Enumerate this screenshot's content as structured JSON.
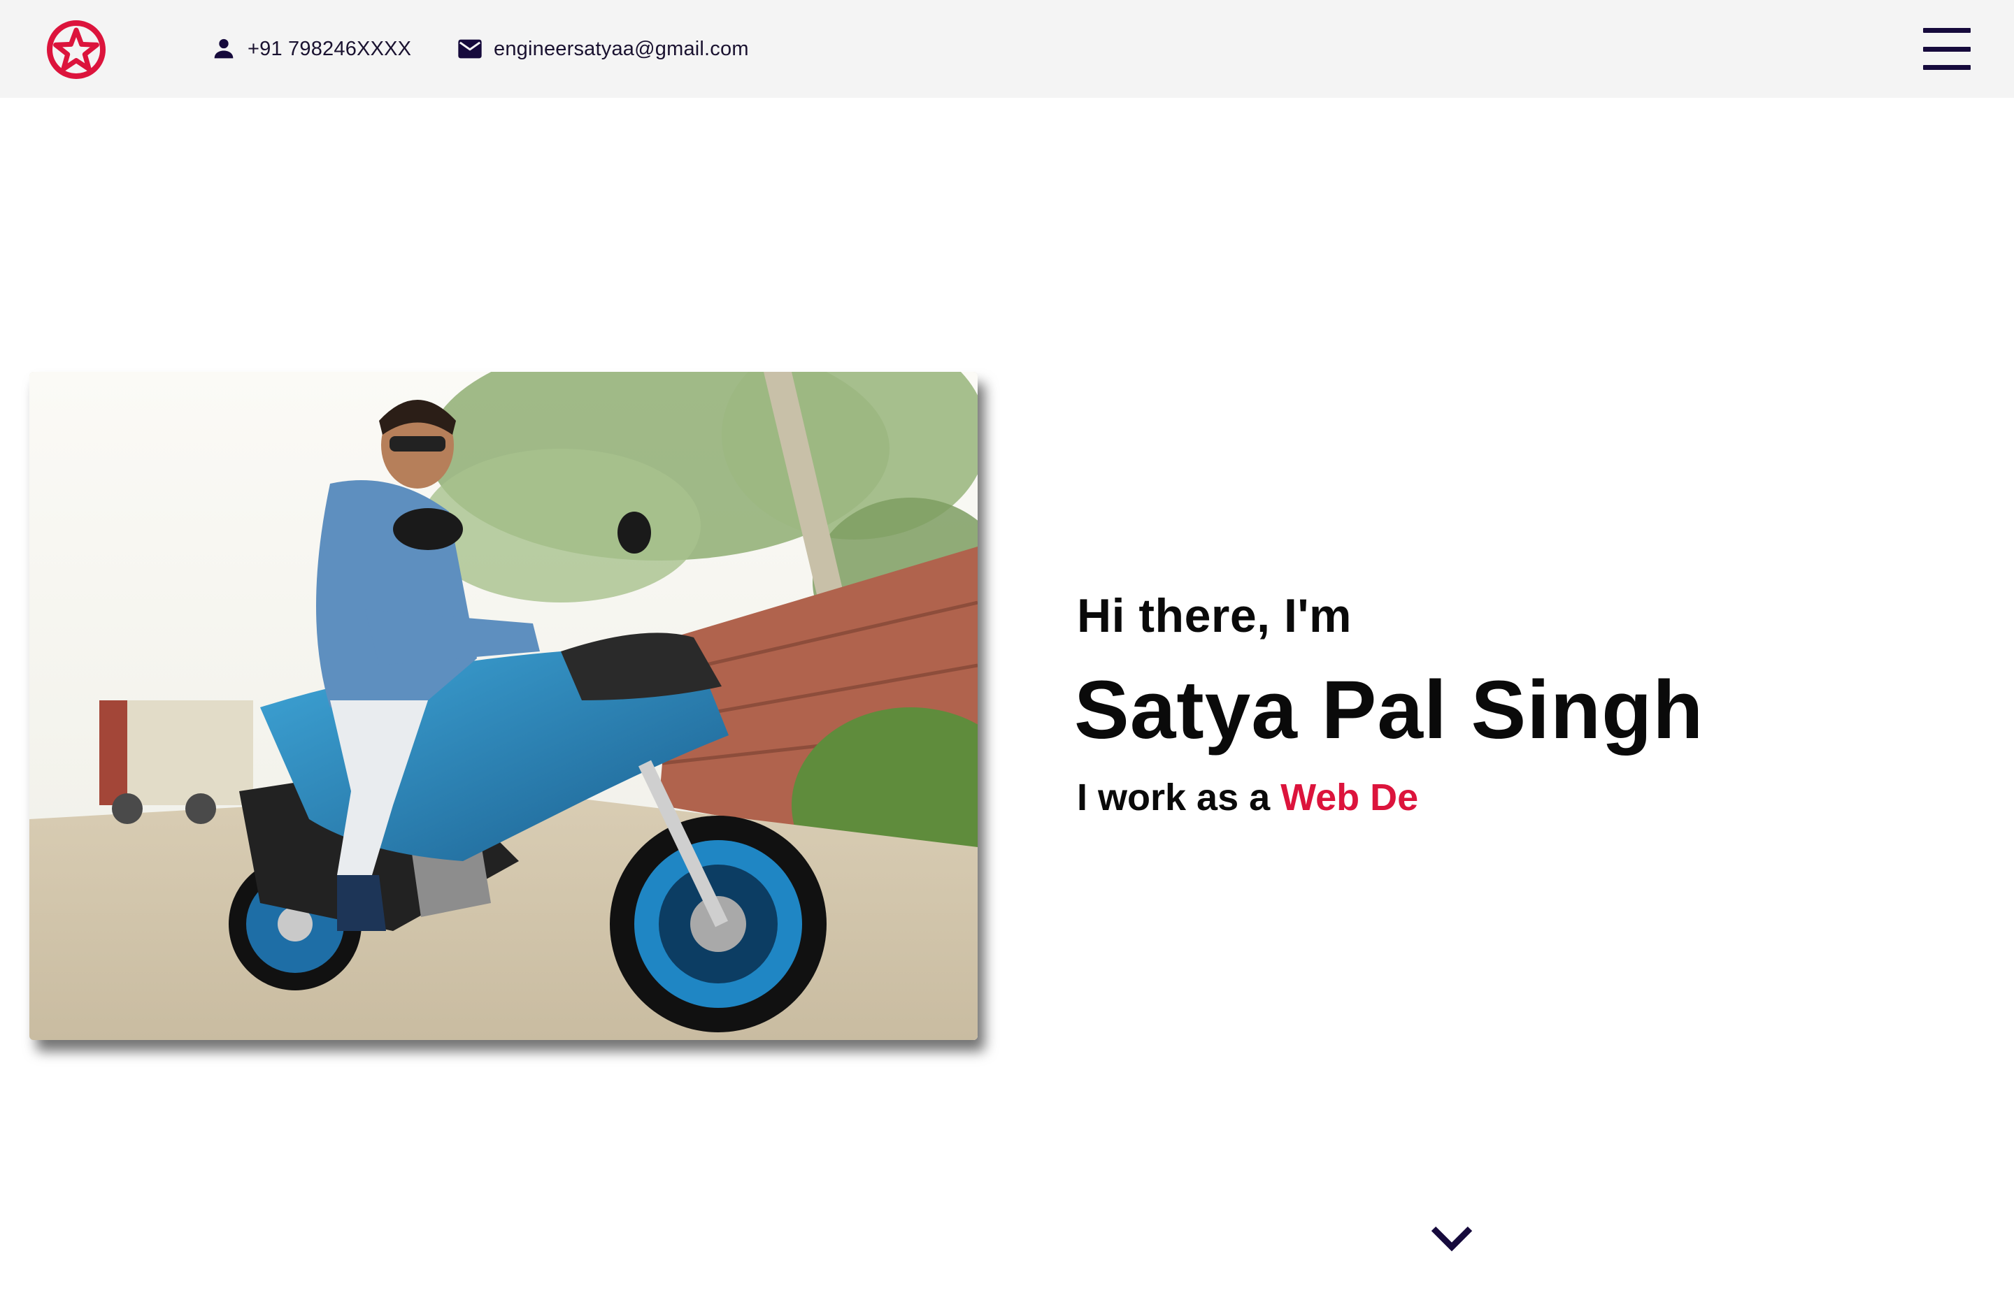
{
  "header": {
    "phone": "+91 798246XXXX",
    "email": "engineersatyaa@gmail.com",
    "icons": {
      "logo": "star-circle-logo",
      "phone": "person-icon",
      "email": "mail-icon",
      "menu": "hamburger-menu-icon"
    }
  },
  "hero": {
    "greeting": "Hi there, I'm",
    "name": "Satya Pal Singh",
    "role_prefix": "I work as a ",
    "role_typed": "Web De",
    "scroll_icon": "chevron-down-icon"
  },
  "colors": {
    "accent": "#dc143c",
    "navy": "#160a3c",
    "header_bg": "#f4f4f4",
    "text": "#0a0a0a"
  }
}
